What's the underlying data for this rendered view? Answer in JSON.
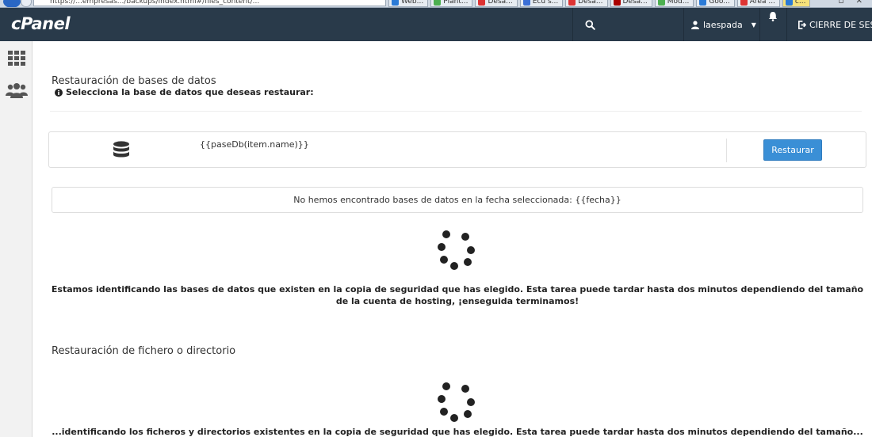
{
  "browser": {
    "url": "https://...empresas.../backups/index.html#/files_content/...",
    "tabs": [
      {
        "label": "Web...",
        "color": "#2a7ad6"
      },
      {
        "label": "Plant...",
        "color": "#4caf50"
      },
      {
        "label": "Desa...",
        "color": "#d33"
      },
      {
        "label": "Ecu s...",
        "color": "#3b6fd6"
      },
      {
        "label": "Desa...",
        "color": "#d33"
      },
      {
        "label": "Desa...",
        "color": "#a00"
      },
      {
        "label": "Mod...",
        "color": "#4caf50"
      },
      {
        "label": "Goo...",
        "color": "#2a7ad6"
      },
      {
        "label": "Área ...",
        "color": "#d33"
      },
      {
        "label": "c...",
        "color": "#2a7ad6",
        "active": true
      }
    ]
  },
  "header": {
    "logo": "cPanel",
    "user": "laespada",
    "logout": "CIERRE DE SESIÓN",
    "colors": {
      "bg": "#293a4a",
      "accent": "#3a8fd6"
    }
  },
  "sidebar": {
    "items": [
      {
        "name": "grid-icon"
      },
      {
        "name": "users-icon"
      }
    ]
  },
  "db_section": {
    "title": "Restauración de bases de datos",
    "subtitle": "Selecciona la base de datos que deseas restaurar:",
    "row_name": "{{paseDb(item.name)}}",
    "restore_label": "Restaurar",
    "not_found": "No hemos encontrado bases de datos en la fecha seleccionada: {{fecha}}",
    "loading_line1": "Estamos identificando las bases de datos que existen en la copia de seguridad que has elegido. Esta tarea puede tardar hasta dos minutos dependiendo del tamaño",
    "loading_line2": "de la cuenta de hosting, ¡enseguida terminamos!"
  },
  "file_section": {
    "title": "Restauración de fichero o directorio",
    "loading_partial": "...identificando los ficheros y directorios existentes en la copia de seguridad que has elegido. Esta tarea puede tardar hasta dos minutos dependiendo del tamaño..."
  }
}
